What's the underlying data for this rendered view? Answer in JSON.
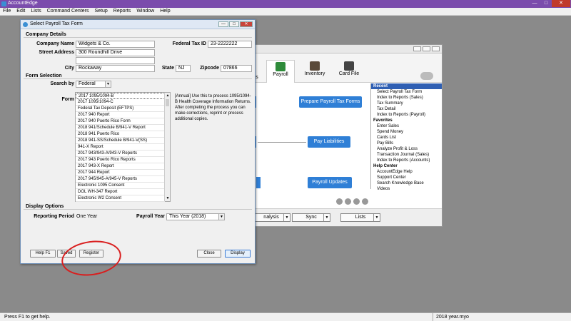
{
  "app": {
    "title": "AccountEdge",
    "menus": [
      "File",
      "Edit",
      "Lists",
      "Command Centers",
      "Setup",
      "Reports",
      "Window",
      "Help"
    ],
    "window_controls": {
      "minimize": "—",
      "maximize": "□",
      "close": "✕"
    }
  },
  "command_center": {
    "tabs": {
      "payroll": "Payroll",
      "inventory": "Inventory",
      "card_file": "Card File",
      "partial_left": "s"
    },
    "flow_buttons": {
      "prepare": "Prepare Payroll Tax Forms",
      "pay_liabilities": "Pay Liabilities",
      "updates": "Payroll Updates"
    },
    "sidebar": {
      "recent_header": "Recent",
      "recent": [
        "Select Payroll Tax Form",
        "Index to Reports (Sales)",
        "Tax Summary",
        "Tax Detail",
        "Index to Reports (Payroll)"
      ],
      "favorites_header": "Favorites",
      "favorites": [
        "Enter Sales",
        "Spend Money",
        "Cards List",
        "Pay Bills",
        "Analyze Profit & Loss",
        "Transaction Journal (Sales)",
        "Index to Reports (Accounts)"
      ],
      "help_header": "Help Center",
      "help": [
        "AccountEdge Help",
        "Support Center",
        "Search Knowledge Base",
        "Videos"
      ]
    },
    "bottom_buttons": {
      "analysis": "nalysis",
      "sync": "Sync",
      "lists": "Lists"
    }
  },
  "dialog": {
    "title": "Select Payroll Tax Form",
    "title_buttons": {
      "minimize": "—",
      "maximize": "□",
      "close": "✕"
    },
    "company": {
      "header": "Company Details",
      "company_name_label": "Company Name",
      "company_name": "Widgets & Co.",
      "street_label": "Street Address",
      "street_line1": "300 Roundhill Drive",
      "street_line2": "",
      "city_label": "City",
      "city": "Rockaway",
      "state_label": "State",
      "state": "NJ",
      "zip_label": "Zipcode",
      "zip": "07866",
      "fed_tax_label": "Federal Tax ID",
      "fed_tax_id": "23-2222222"
    },
    "form_selection": {
      "header": "Form Selection",
      "search_by_label": "Search by",
      "search_by": "Federal",
      "form_label": "Form",
      "forms": [
        "2017 1095/1094-B",
        "2017 1095/1094-C",
        "Federal Tax Deposit (EFTPS)",
        "2017 940 Report",
        "2017 940 Puerto Rico Form",
        "2018 941/Schedule B/941-V Report",
        "2018 941 Puerto Rico",
        "2018 941-SS/Schedule B/941-V(SS)",
        "941-X Report",
        "2017 943/943-A/943-V Reports",
        "2017 943 Puerto Rico Reports",
        "2017 943-X Report",
        "2017 944 Report",
        "2017 945/945-A/945-V Reports",
        "Electronic 1095 Consent",
        "DOL WH-347 Report",
        "Electronic W2 Consent"
      ],
      "selected_index": 0,
      "description": "[Annual] Use this to process 1095/1094-B Health Coverage Information Returns. After completing the process you can make corrections, reprint or process additional copies."
    },
    "display_options": {
      "header": "Display Options",
      "reporting_period_label": "Reporting Period",
      "reporting_period": "One Year",
      "payroll_year_label": "Payroll Year",
      "payroll_year": "This Year (2018)"
    },
    "buttons": {
      "help": "Help F1",
      "saved": "Saved",
      "register": "Register",
      "close": "Close",
      "display": "Display"
    }
  },
  "status": {
    "left": "Press F1 to get help.",
    "right": "2018 year.myo"
  },
  "colors": {
    "title_bar": "#7b4cac",
    "accent_blue": "#2f7fd6",
    "annotation_red": "#d91e1e",
    "sidebar_header": "#2f5fb3"
  }
}
